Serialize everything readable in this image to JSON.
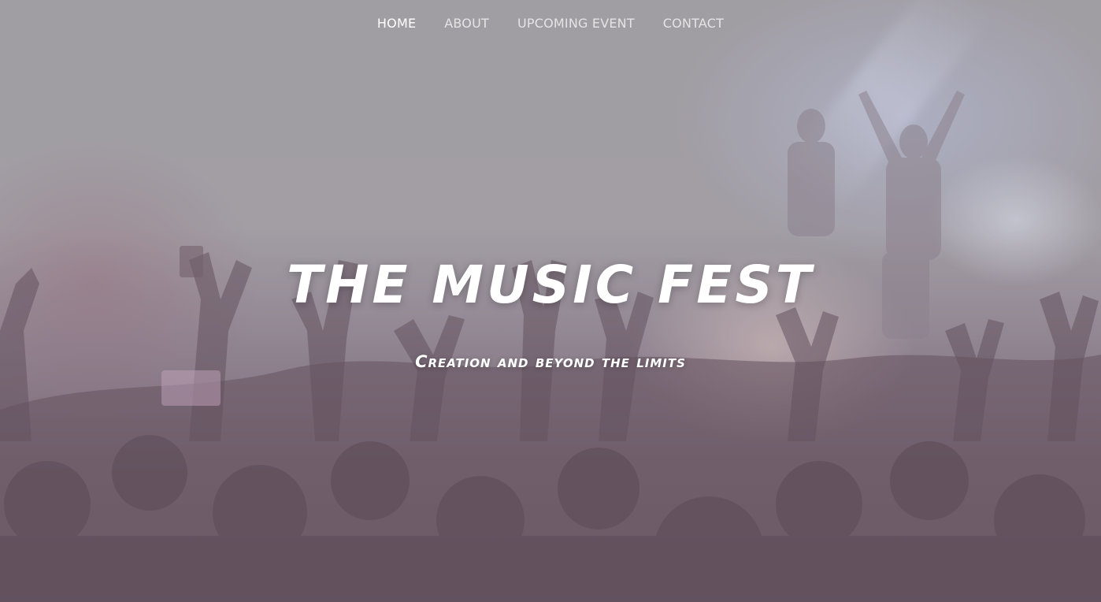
{
  "nav": {
    "items": [
      {
        "label": "HOME",
        "active": true
      },
      {
        "label": "ABOUT",
        "active": false
      },
      {
        "label": "UPCOMING EVENT",
        "active": false
      },
      {
        "label": "CONTACT",
        "active": false
      }
    ]
  },
  "hero": {
    "title": "THE MUSIC FEST",
    "subtitle": "Creation and beyond the limits",
    "background": "concert-crowd-photo"
  },
  "colors": {
    "text": "#ffffff",
    "nav_inactive": "rgba(255,255,255,0.72)",
    "overlay": "#9a949b"
  }
}
